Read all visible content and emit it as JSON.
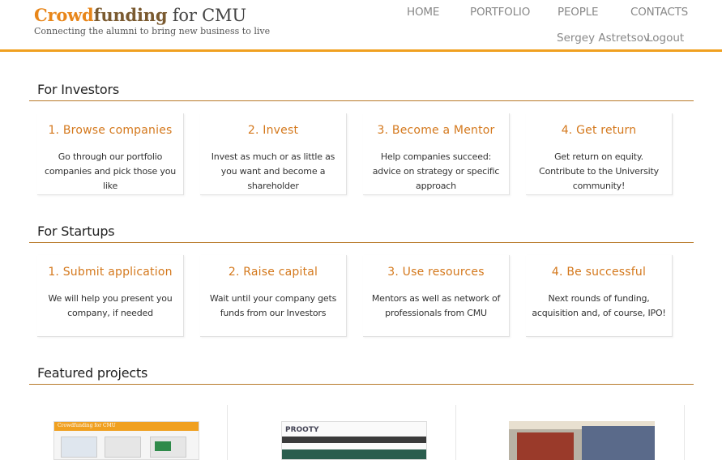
{
  "header": {
    "logo_crowd": "Crowd",
    "logo_funding": "funding",
    "logo_rest": " for CMU",
    "tagline": "Connecting the alumni to bring new business to live"
  },
  "nav": {
    "home": "HOME",
    "portfolio": "PORTFOLIO",
    "people": "PEOPLE",
    "contacts": "CONTACTS",
    "user": "Sergey Astretsov",
    "logout": "Logout"
  },
  "investors": {
    "title": "For Investors",
    "cards": [
      {
        "title": "1. Browse companies",
        "text": "Go through our portfolio companies and pick those you like"
      },
      {
        "title": "2. Invest",
        "text": "Invest as much or as little as you want and become a shareholder"
      },
      {
        "title": "3. Become a Mentor",
        "text": "Help companies succeed: advice on strategy or specific approach"
      },
      {
        "title": "4. Get return",
        "text": "Get return on equity. Contribute to the University community!"
      }
    ]
  },
  "startups": {
    "title": "For Startups",
    "cards": [
      {
        "title": "1. Submit application",
        "text": "We will help you present you company, if needed"
      },
      {
        "title": "2. Raise capital",
        "text": "Wait until your company gets funds from our Investors"
      },
      {
        "title": "3. Use resources",
        "text": "Mentors as well as network of professionals from CMU"
      },
      {
        "title": "4. Be successful",
        "text": "Next rounds of funding, acquisition and, of course, IPO!"
      }
    ]
  },
  "featured": {
    "title": "Featured projects",
    "projects": [
      {
        "thumb_text": "Crowdfunding for CMU"
      },
      {
        "thumb_text": "PROOTY"
      },
      {
        "thumb_text": ""
      }
    ]
  },
  "colors": {
    "accent": "#e8861a",
    "card_title": "#d4781c",
    "rule": "#b87a2a"
  }
}
